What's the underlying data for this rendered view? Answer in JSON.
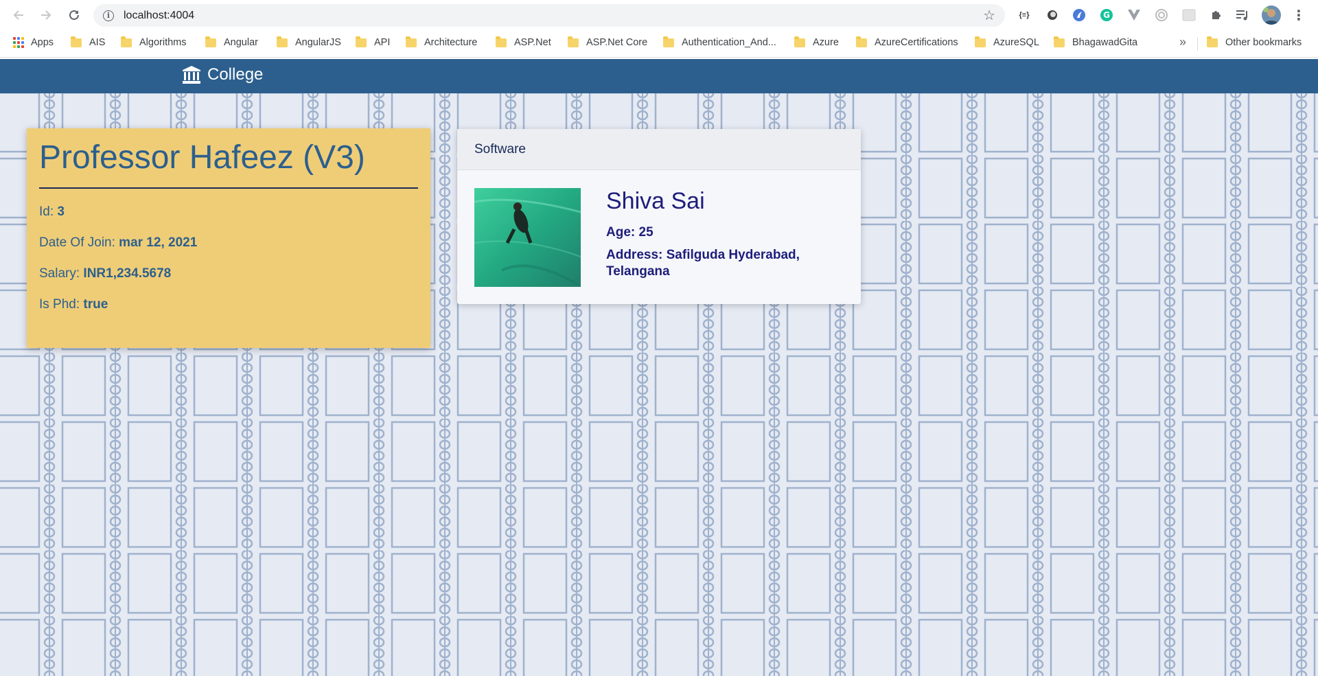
{
  "browser": {
    "url": "localhost:4004",
    "bookmarks": [
      {
        "label": "Apps",
        "type": "apps"
      },
      {
        "label": "AIS",
        "type": "folder"
      },
      {
        "label": "Algorithms",
        "type": "folder"
      },
      {
        "label": "Angular",
        "type": "folder"
      },
      {
        "label": "AngularJS",
        "type": "folder"
      },
      {
        "label": "API",
        "type": "folder"
      },
      {
        "label": "Architecture",
        "type": "folder"
      },
      {
        "label": "ASP.Net",
        "type": "folder"
      },
      {
        "label": "ASP.Net Core",
        "type": "folder"
      },
      {
        "label": "Authentication_And...",
        "type": "folder"
      },
      {
        "label": "Azure",
        "type": "folder"
      },
      {
        "label": "AzureCertifications",
        "type": "folder"
      },
      {
        "label": "AzureSQL",
        "type": "folder"
      },
      {
        "label": "BhagawadGita",
        "type": "folder"
      }
    ],
    "overflow_label": "»",
    "other_bookmarks": "Other bookmarks",
    "extensions": [
      "json-viewer-icon",
      "circle-extension-icon",
      "blue-extension-icon",
      "grammarly-icon",
      "vue-devtools-icon",
      "target-extension-icon",
      "screenshot-extension-icon",
      "puzzle-icon",
      "reading-list-icon",
      "avatar",
      "kebab-menu-icon"
    ],
    "json_ext_label": "{≡}"
  },
  "app": {
    "brand": "College",
    "brand_icon": "institution-icon",
    "brand_color": "#2c5f8d"
  },
  "professor": {
    "title": "Professor Hafeez (V3)",
    "id_label": "Id: ",
    "id_value": "3",
    "doj_label": "Date Of Join: ",
    "doj_value": "mar 12, 2021",
    "salary_label": "Salary: ",
    "salary_value": "INR1,234.5678",
    "phd_label": "Is Phd: ",
    "phd_value": "true",
    "card_color": "#efcd77"
  },
  "student": {
    "header": "Software",
    "name": "Shiva Sai",
    "age": "Age: 25",
    "address": "Address: Safilguda Hyderabad, Telangana",
    "photo": "student-photo"
  }
}
